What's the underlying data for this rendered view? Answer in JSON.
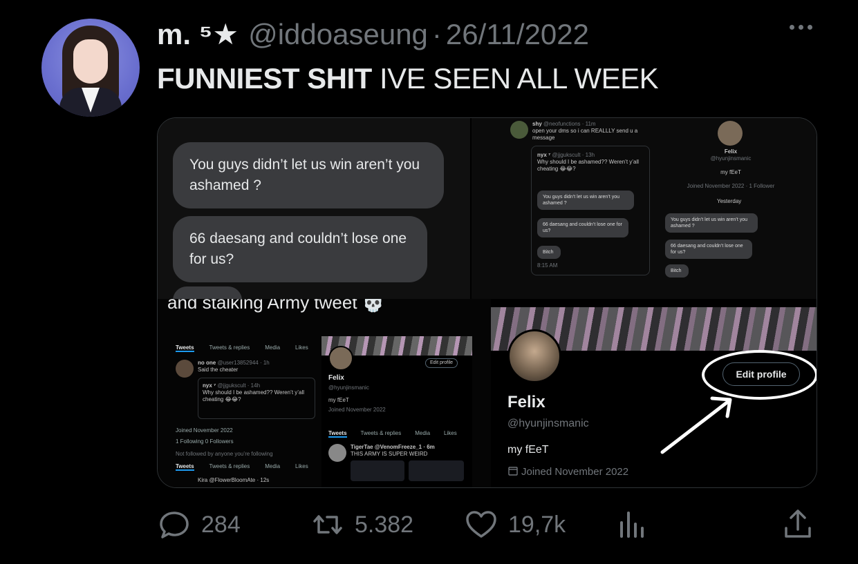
{
  "tweet": {
    "display_name": "m. ⁵★",
    "handle": "@iddoaseung",
    "separator": "·",
    "date": "26/11/2022",
    "text_bold": "FUNNIEST SHIT",
    "text_rest": " IVE SEEN ALL WEEK"
  },
  "media": {
    "top_left": {
      "bubble1": "You guys didn’t let us win aren’t you ashamed ?",
      "bubble2": "66 daesang and couldn’t lose one for us?"
    },
    "top_right": {
      "reply_user": "shy",
      "reply_handle": "@neofunctions · 11m",
      "reply_text": "open your dms so i can REALLLY send u a message",
      "quote_user": "nyx ⁷",
      "quote_handle": "@jjgukscult · 13h",
      "quote_text": "Why should I be ashamed?? Weren’t y’all cheating 😂😂?",
      "q_b1": "You guys didn’t let us win aren’t you ashamed ?",
      "q_b2": "66 daesang and couldn’t lose one for us?",
      "q_b3": "Bitch",
      "q_time": "8:15 AM",
      "profile_name": "Felix",
      "profile_handle": "@hyunjinsmanic",
      "profile_bio": "my fEeT",
      "profile_meta": "Joined November 2022 · 1 Follower",
      "yesterday": "Yesterday",
      "dm_b1": "You guys didn’t let us win aren’t you ashamed ?",
      "dm_b2": "66 daesang and couldn’t lose one for us?",
      "dm_b3": "Bitch"
    },
    "bottom_left": {
      "caption": "and stalking Army tweet 💀",
      "tabs": [
        "Tweets",
        "Tweets & replies",
        "Media",
        "Likes"
      ],
      "reply_user": "no one",
      "reply_handle": "@user13852944 · 1h",
      "reply_text": "Said the cheater",
      "quote_user": "nyx ⁷",
      "quote_handle": "@jjgukscult · 14h",
      "quote_text": "Why should I be ashamed?? Weren’t y’all cheating 😂😂?",
      "joined": "Joined November 2022",
      "following": "1 Following   0 Followers",
      "not_followed": "Not followed by anyone you’re following",
      "kira": "Kira @FlowerBloomAte · 12s",
      "mini_name": "Felix",
      "mini_handle": "@hyunjinsmanic",
      "mini_bio": "my fEeT",
      "mini_joined": "Joined November 2022",
      "mini_edit": "Edit profile",
      "tiger_user": "TigerTae @VenomFreeze_1 · 6m",
      "tiger_text": "THIS ARMY IS SUPER WEIRD"
    },
    "bottom_right": {
      "edit_label": "Edit profile",
      "name": "Felix",
      "handle": "@hyunjinsmanic",
      "bio": "my fEeT",
      "joined": "Joined November 2022"
    }
  },
  "actions": {
    "replies": "284",
    "retweets": "5.382",
    "likes": "19,7k"
  },
  "icons": [
    "more-icon",
    "reply-icon",
    "retweet-icon",
    "like-icon",
    "views-icon",
    "share-icon",
    "calendar-icon",
    "arrow-icon",
    "skull-icon"
  ],
  "colors": {
    "background": "#000000",
    "text": "#e7e9ea",
    "muted": "#71767b",
    "bubble": "#3a3b3e"
  }
}
